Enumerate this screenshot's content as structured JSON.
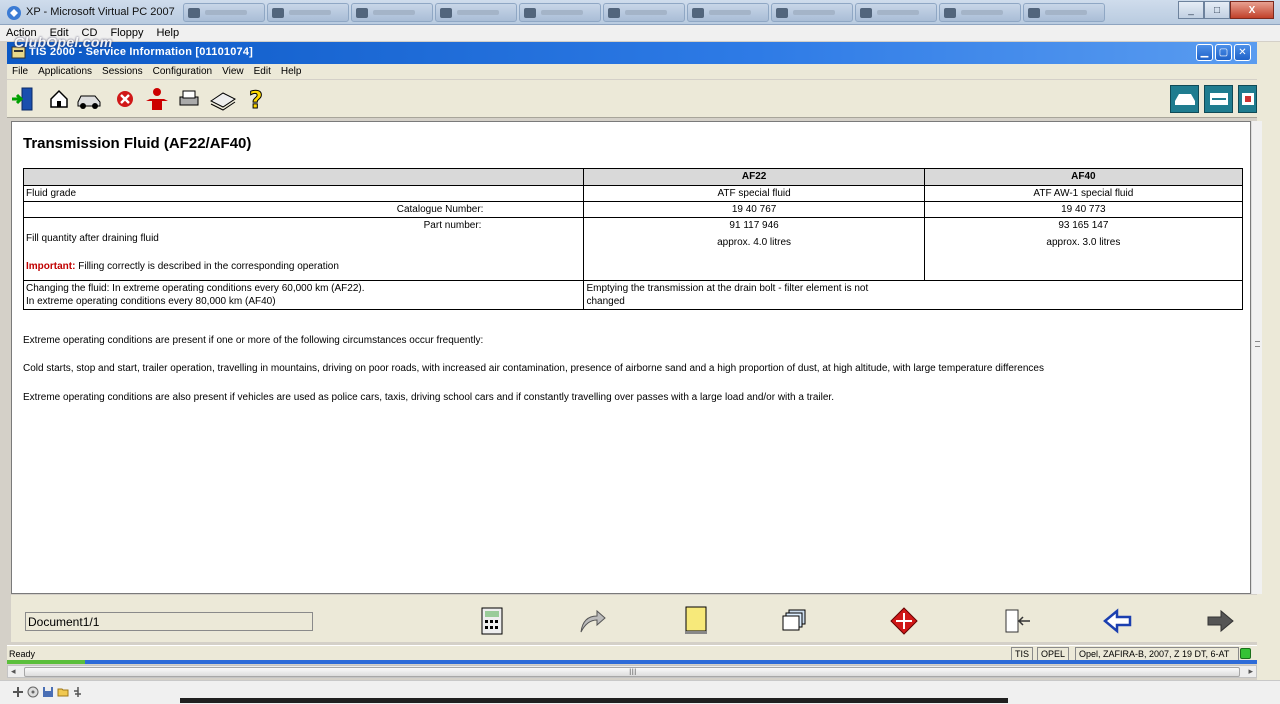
{
  "outer_window": {
    "title": "XP - Microsoft Virtual PC 2007",
    "controls": {
      "minimize": "_",
      "maximize": "□",
      "close": "X"
    }
  },
  "vpc_menu": [
    "Action",
    "Edit",
    "CD",
    "Floppy",
    "Help"
  ],
  "tis_window": {
    "title": "TIS 2000 - Service Information [01101074]",
    "watermark": "ClubOpel.com"
  },
  "tis_menu": [
    "File",
    "Applications",
    "Sessions",
    "Configuration",
    "View",
    "Edit",
    "Help"
  ],
  "toolbar_icons": [
    "exit-icon",
    "home-icon",
    "vehicle-icon",
    "stop-icon",
    "person-icon",
    "print-icon",
    "catalogue-icon",
    "help-icon"
  ],
  "document": {
    "title": "Transmission Fluid (AF22/AF40)",
    "table": {
      "headers": [
        "",
        "AF22",
        "AF40"
      ],
      "rows": {
        "fluid_grade": {
          "label": "Fluid grade",
          "af22": "ATF special fluid",
          "af40": "ATF AW-1 special fluid"
        },
        "catalogue_number": {
          "label": "Catalogue Number:",
          "af22": "19 40 767",
          "af40": "19 40 773"
        },
        "part_number": {
          "label": "Part number:",
          "fill_label": "Fill quantity after draining fluid",
          "important_label": "Important:",
          "important_text": "Filling correctly is described in the corresponding operation",
          "af22_part": "91 117 946",
          "af22_fill": "approx. 4.0 litres",
          "af40_part": "93 165 147",
          "af40_fill": "approx. 3.0 litres"
        },
        "changing": {
          "line1": "Changing the fluid: In extreme operating conditions every 60,000 km (AF22).",
          "line2": "In extreme operating conditions every 80,000 km (AF40)",
          "note_line1": "Emptying the transmission at the drain bolt - filter element is not",
          "note_line2": "changed"
        }
      }
    },
    "paragraphs": [
      "Extreme operating conditions are present if one or more of the following circumstances occur frequently:",
      "Cold starts, stop and start, trailer operation, travelling in mountains, driving on poor roads, with increased air contamination, presence of airborne sand and a high proportion of dust, at high altitude, with large temperature differences",
      "Extreme operating conditions are also present if vehicles are used as police cars, taxis, driving school cars and if constantly travelling over passes with a large load and/or with a trailer."
    ]
  },
  "navbar": {
    "document_counter": "Document1/1",
    "icons": [
      "calculator-icon",
      "redo-arrow-icon",
      "notepad-icon",
      "documents-icon",
      "navigator-icon",
      "export-icon",
      "back-arrow-icon",
      "forward-arrow-icon"
    ]
  },
  "statusbar": {
    "ready": "Ready",
    "mode": "TIS",
    "brand": "OPEL",
    "vehicle": "Opel, ZAFIRA-B, 2007, Z 19 DT, 6-AT"
  },
  "hscroll": {
    "grip": "III"
  }
}
